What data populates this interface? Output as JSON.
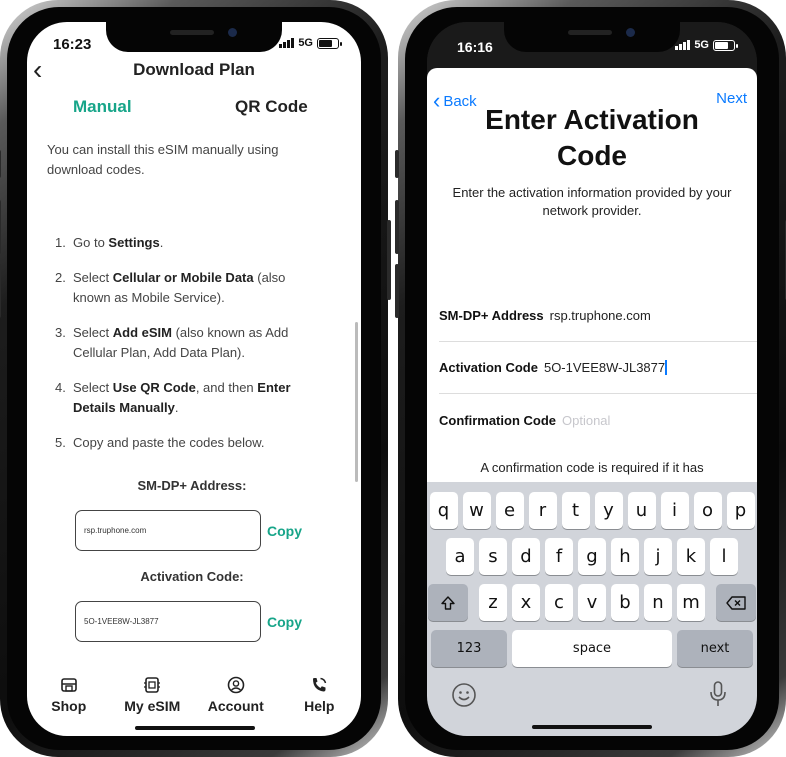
{
  "left": {
    "status_time": "16:23",
    "network": "5G",
    "title": "Download Plan",
    "tabs": {
      "manual": "Manual",
      "qr": "QR Code"
    },
    "intro": "You can install this eSIM manually using download codes.",
    "steps": [
      {
        "num": "1.",
        "pre": "Go to ",
        "b1": "Settings",
        "mid": ".",
        "b2": "",
        "post": ""
      },
      {
        "num": "2.",
        "pre": "Select ",
        "b1": "Cellular or Mobile Data",
        "mid": " (also known as Mobile Service).",
        "b2": "",
        "post": ""
      },
      {
        "num": "3.",
        "pre": "Select ",
        "b1": "Add eSIM",
        "mid": " (also known as Add Cellular Plan, Add Data Plan).",
        "b2": "",
        "post": ""
      },
      {
        "num": "4.",
        "pre": "Select ",
        "b1": "Use QR Code",
        "mid": ", and then ",
        "b2": "Enter Details Manually",
        "post": "."
      },
      {
        "num": "5.",
        "pre": "Copy and paste the codes below.",
        "b1": "",
        "mid": "",
        "b2": "",
        "post": ""
      }
    ],
    "smdp_label": "SM-DP+ Address:",
    "smdp_value": "rsp.truphone.com",
    "activation_label": "Activation Code:",
    "activation_value": "5O-1VEE8W-JL3877",
    "copy_label": "Copy",
    "nav": [
      {
        "label": "Shop",
        "icon": "shop-icon"
      },
      {
        "label": "My eSIM",
        "icon": "sim-chip-icon"
      },
      {
        "label": "Account",
        "icon": "account-icon"
      },
      {
        "label": "Help",
        "icon": "phone-help-icon"
      }
    ],
    "accent": "#17a589"
  },
  "right": {
    "status_time": "16:16",
    "network": "5G",
    "back_label": "Back",
    "next_label": "Next",
    "title_line1": "Enter Activation",
    "title_line2": "Code",
    "subtitle": "Enter the activation information provided by your network provider.",
    "smdp_key": "SM-DP+ Address",
    "smdp_value": "rsp.truphone.com",
    "activation_key": "Activation Code",
    "activation_value": "5O-1VEE8W-JL3877",
    "confirmation_key": "Confirmation Code",
    "confirmation_placeholder": "Optional",
    "confirmation_note": "A confirmation code is required if it has",
    "keyboard": {
      "row1": [
        "q",
        "w",
        "e",
        "r",
        "t",
        "y",
        "u",
        "i",
        "o",
        "p"
      ],
      "row2": [
        "a",
        "s",
        "d",
        "f",
        "g",
        "h",
        "j",
        "k",
        "l"
      ],
      "row3": [
        "z",
        "x",
        "c",
        "v",
        "b",
        "n",
        "m"
      ],
      "numbers": "123",
      "space": "space",
      "return": "next"
    },
    "accent": "#0a7aff"
  }
}
